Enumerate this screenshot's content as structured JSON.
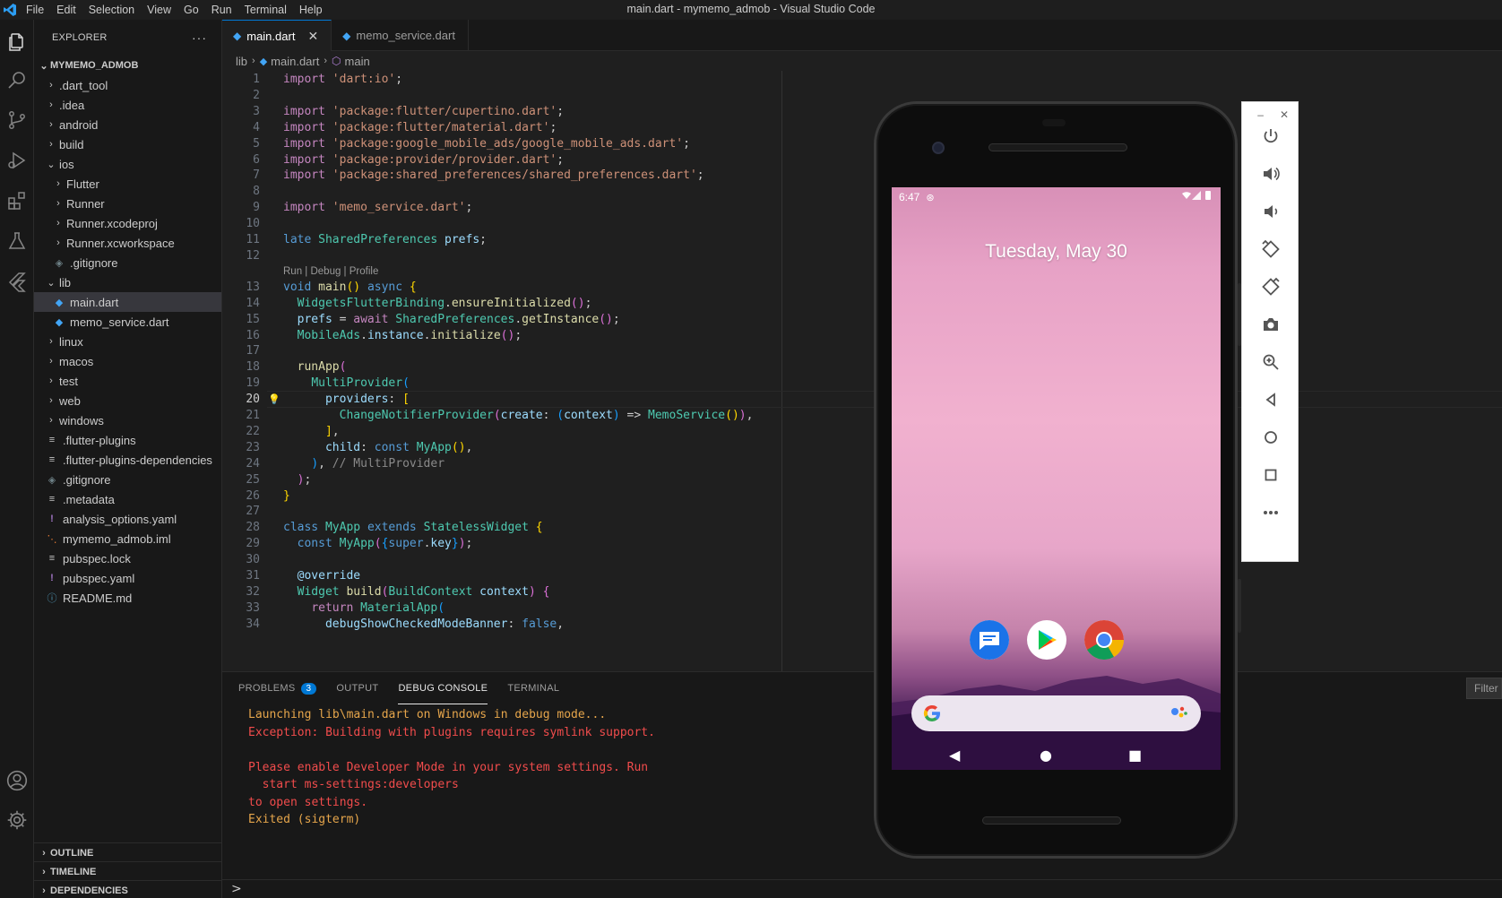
{
  "window": {
    "title": "main.dart - mymemo_admob - Visual Studio Code",
    "menu": [
      "File",
      "Edit",
      "Selection",
      "View",
      "Go",
      "Run",
      "Terminal",
      "Help"
    ]
  },
  "explorer": {
    "header": "EXPLORER",
    "more": "···",
    "root": "MYMEMO_ADMOB",
    "items": [
      {
        "label": ".dart_tool",
        "kind": "folder",
        "depth": 1
      },
      {
        "label": ".idea",
        "kind": "folder",
        "depth": 1
      },
      {
        "label": "android",
        "kind": "folder",
        "depth": 1
      },
      {
        "label": "build",
        "kind": "folder",
        "depth": 1
      },
      {
        "label": "ios",
        "kind": "folder-open",
        "depth": 1
      },
      {
        "label": "Flutter",
        "kind": "folder",
        "depth": 2
      },
      {
        "label": "Runner",
        "kind": "folder",
        "depth": 2
      },
      {
        "label": "Runner.xcodeproj",
        "kind": "folder",
        "depth": 2
      },
      {
        "label": "Runner.xcworkspace",
        "kind": "folder",
        "depth": 2
      },
      {
        "label": ".gitignore",
        "kind": "git",
        "depth": 2
      },
      {
        "label": "lib",
        "kind": "folder-open",
        "depth": 1
      },
      {
        "label": "main.dart",
        "kind": "dart",
        "depth": 2,
        "selected": true
      },
      {
        "label": "memo_service.dart",
        "kind": "dart",
        "depth": 2
      },
      {
        "label": "linux",
        "kind": "folder",
        "depth": 1
      },
      {
        "label": "macos",
        "kind": "folder",
        "depth": 1
      },
      {
        "label": "test",
        "kind": "folder",
        "depth": 1
      },
      {
        "label": "web",
        "kind": "folder",
        "depth": 1
      },
      {
        "label": "windows",
        "kind": "folder",
        "depth": 1
      },
      {
        "label": ".flutter-plugins",
        "kind": "lines",
        "depth": 1
      },
      {
        "label": ".flutter-plugins-dependencies",
        "kind": "lines",
        "depth": 1
      },
      {
        "label": ".gitignore",
        "kind": "git",
        "depth": 1
      },
      {
        "label": ".metadata",
        "kind": "lines",
        "depth": 1
      },
      {
        "label": "analysis_options.yaml",
        "kind": "yaml",
        "depth": 1
      },
      {
        "label": "mymemo_admob.iml",
        "kind": "rss",
        "depth": 1
      },
      {
        "label": "pubspec.lock",
        "kind": "lines",
        "depth": 1
      },
      {
        "label": "pubspec.yaml",
        "kind": "yaml",
        "depth": 1
      },
      {
        "label": "README.md",
        "kind": "info",
        "depth": 1
      }
    ],
    "sections": [
      "OUTLINE",
      "TIMELINE",
      "DEPENDENCIES"
    ]
  },
  "editor": {
    "tabs": [
      {
        "label": "main.dart",
        "active": true,
        "close": "✕"
      },
      {
        "label": "memo_service.dart",
        "active": false
      }
    ],
    "breadcrumb": [
      "lib",
      "main.dart",
      "main"
    ],
    "codelens": "Run | Debug | Profile",
    "current_line": 20,
    "lines": [
      {
        "n": "1",
        "t": [
          [
            "kw2",
            "import "
          ],
          [
            "str",
            "'dart:io'"
          ],
          [
            "",
            ";"
          ]
        ]
      },
      {
        "n": "2",
        "t": []
      },
      {
        "n": "3",
        "t": [
          [
            "kw2",
            "import "
          ],
          [
            "str",
            "'package:flutter/cupertino.dart'"
          ],
          [
            "",
            ";"
          ]
        ]
      },
      {
        "n": "4",
        "t": [
          [
            "kw2",
            "import "
          ],
          [
            "str",
            "'package:flutter/material.dart'"
          ],
          [
            "",
            ";"
          ]
        ]
      },
      {
        "n": "5",
        "t": [
          [
            "kw2",
            "import "
          ],
          [
            "str",
            "'package:google_mobile_ads/google_mobile_ads.dart'"
          ],
          [
            "",
            ";"
          ]
        ]
      },
      {
        "n": "6",
        "t": [
          [
            "kw2",
            "import "
          ],
          [
            "str",
            "'package:provider/provider.dart'"
          ],
          [
            "",
            ";"
          ]
        ]
      },
      {
        "n": "7",
        "t": [
          [
            "kw2",
            "import "
          ],
          [
            "str",
            "'package:shared_preferences/shared_preferences.dart'"
          ],
          [
            "",
            ";"
          ]
        ]
      },
      {
        "n": "8",
        "t": []
      },
      {
        "n": "9",
        "t": [
          [
            "kw2",
            "import "
          ],
          [
            "str",
            "'memo_service.dart'"
          ],
          [
            "",
            ";"
          ]
        ]
      },
      {
        "n": "10",
        "t": []
      },
      {
        "n": "11",
        "t": [
          [
            "kw",
            "late "
          ],
          [
            "cls",
            "SharedPreferences "
          ],
          [
            "var",
            "prefs"
          ],
          [
            "",
            ";"
          ]
        ]
      },
      {
        "n": "12",
        "t": []
      },
      {
        "n": "13",
        "t": [
          [
            "kw",
            "void "
          ],
          [
            "fn",
            "main"
          ],
          [
            "br1",
            "() "
          ],
          [
            "kw",
            "async "
          ],
          [
            "br1",
            "{"
          ]
        ]
      },
      {
        "n": "14",
        "t": [
          [
            "",
            "  "
          ],
          [
            "cls",
            "WidgetsFlutterBinding"
          ],
          [
            "",
            "."
          ],
          [
            "fn",
            "ensureInitialized"
          ],
          [
            "br2",
            "()"
          ],
          [
            "",
            ";"
          ]
        ]
      },
      {
        "n": "15",
        "t": [
          [
            "",
            "  "
          ],
          [
            "var",
            "prefs "
          ],
          [
            "",
            "= "
          ],
          [
            "kw2",
            "await "
          ],
          [
            "cls",
            "SharedPreferences"
          ],
          [
            "",
            "."
          ],
          [
            "fn",
            "getInstance"
          ],
          [
            "br2",
            "()"
          ],
          [
            "",
            ";"
          ]
        ]
      },
      {
        "n": "16",
        "t": [
          [
            "",
            "  "
          ],
          [
            "cls",
            "MobileAds"
          ],
          [
            "",
            "."
          ],
          [
            "var",
            "instance"
          ],
          [
            "",
            "."
          ],
          [
            "fn",
            "initialize"
          ],
          [
            "br2",
            "()"
          ],
          [
            "",
            ";"
          ]
        ]
      },
      {
        "n": "17",
        "t": []
      },
      {
        "n": "18",
        "t": [
          [
            "",
            "  "
          ],
          [
            "fn",
            "runApp"
          ],
          [
            "br2",
            "("
          ]
        ]
      },
      {
        "n": "19",
        "t": [
          [
            "",
            "    "
          ],
          [
            "cls",
            "MultiProvider"
          ],
          [
            "br3",
            "("
          ]
        ]
      },
      {
        "n": "20",
        "t": [
          [
            "",
            "      "
          ],
          [
            "var",
            "providers"
          ],
          [
            "",
            ": "
          ],
          [
            "br1",
            "["
          ]
        ]
      },
      {
        "n": "21",
        "t": [
          [
            "",
            "        "
          ],
          [
            "cls",
            "ChangeNotifierProvider"
          ],
          [
            "br2",
            "("
          ],
          [
            "var",
            "create"
          ],
          [
            "",
            ": "
          ],
          [
            "br3",
            "("
          ],
          [
            "var",
            "context"
          ],
          [
            "br3",
            ") "
          ],
          [
            "",
            "=> "
          ],
          [
            "cls",
            "MemoService"
          ],
          [
            "br1",
            "()"
          ],
          [
            "br2",
            ")"
          ],
          [
            "",
            ","
          ]
        ]
      },
      {
        "n": "22",
        "t": [
          [
            "",
            "      "
          ],
          [
            "br1",
            "]"
          ],
          [
            "",
            ","
          ]
        ]
      },
      {
        "n": "23",
        "t": [
          [
            "",
            "      "
          ],
          [
            "var",
            "child"
          ],
          [
            "",
            ": "
          ],
          [
            "kw",
            "const "
          ],
          [
            "cls",
            "MyApp"
          ],
          [
            "br1",
            "()"
          ],
          [
            "",
            ","
          ]
        ]
      },
      {
        "n": "24",
        "t": [
          [
            "",
            "    "
          ],
          [
            "br3",
            ")"
          ],
          [
            "",
            ", "
          ],
          [
            "gry",
            "// MultiProvider"
          ]
        ]
      },
      {
        "n": "25",
        "t": [
          [
            "",
            "  "
          ],
          [
            "br2",
            ")"
          ],
          [
            "",
            ";"
          ]
        ]
      },
      {
        "n": "26",
        "t": [
          [
            "br1",
            "}"
          ]
        ]
      },
      {
        "n": "27",
        "t": []
      },
      {
        "n": "28",
        "t": [
          [
            "kw",
            "class "
          ],
          [
            "cls",
            "MyApp "
          ],
          [
            "kw",
            "extends "
          ],
          [
            "cls",
            "StatelessWidget "
          ],
          [
            "br1",
            "{"
          ]
        ]
      },
      {
        "n": "29",
        "t": [
          [
            "",
            "  "
          ],
          [
            "kw",
            "const "
          ],
          [
            "cls",
            "MyApp"
          ],
          [
            "br2",
            "("
          ],
          [
            "br3",
            "{"
          ],
          [
            "kw",
            "super"
          ],
          [
            "",
            "."
          ],
          [
            "var",
            "key"
          ],
          [
            "br3",
            "}"
          ],
          [
            "br2",
            ")"
          ],
          [
            "",
            ";"
          ]
        ]
      },
      {
        "n": "30",
        "t": []
      },
      {
        "n": "31",
        "t": [
          [
            "",
            "  "
          ],
          [
            "var",
            "@override"
          ]
        ]
      },
      {
        "n": "32",
        "t": [
          [
            "",
            "  "
          ],
          [
            "cls",
            "Widget "
          ],
          [
            "fn",
            "build"
          ],
          [
            "br2",
            "("
          ],
          [
            "cls",
            "BuildContext "
          ],
          [
            "var",
            "context"
          ],
          [
            "br2",
            ") "
          ],
          [
            "br2",
            "{"
          ]
        ]
      },
      {
        "n": "33",
        "t": [
          [
            "",
            "    "
          ],
          [
            "kw2",
            "return "
          ],
          [
            "cls",
            "MaterialApp"
          ],
          [
            "br3",
            "("
          ]
        ]
      },
      {
        "n": "34",
        "t": [
          [
            "",
            "      "
          ],
          [
            "var",
            "debugShowCheckedModeBanner"
          ],
          [
            "",
            ": "
          ],
          [
            "kw",
            "false"
          ],
          [
            "",
            ","
          ]
        ]
      }
    ]
  },
  "panel": {
    "tabs": [
      {
        "label": "PROBLEMS",
        "badge": "3"
      },
      {
        "label": "OUTPUT"
      },
      {
        "label": "DEBUG CONSOLE",
        "active": true
      },
      {
        "label": "TERMINAL"
      }
    ],
    "filter_placeholder": "Filter",
    "prompt": ">",
    "console": [
      {
        "text": "Launching lib\\main.dart on Windows in debug mode...",
        "color": "orange"
      },
      {
        "text": "Exception: Building with plugins requires symlink support.",
        "color": "red"
      },
      {
        "text": "",
        "color": "red"
      },
      {
        "text": "Please enable Developer Mode in your system settings. Run",
        "color": "red"
      },
      {
        "text": "  start ms-settings:developers",
        "color": "red"
      },
      {
        "text": "to open settings.",
        "color": "red"
      },
      {
        "text": "Exited (sigterm)",
        "color": "orange"
      }
    ]
  },
  "emulator": {
    "status_time": "6:47",
    "date": "Tuesday, May 30",
    "apps": [
      "messages-icon",
      "play-store-icon",
      "chrome-icon"
    ],
    "toolbar": {
      "minimize": "–",
      "close": "✕",
      "buttons": [
        "power-icon",
        "volume-up-icon",
        "volume-down-icon",
        "rotate-left-icon",
        "rotate-right-icon",
        "camera-icon",
        "zoom-icon",
        "back-icon",
        "home-icon",
        "overview-icon",
        "more-icon"
      ]
    }
  }
}
